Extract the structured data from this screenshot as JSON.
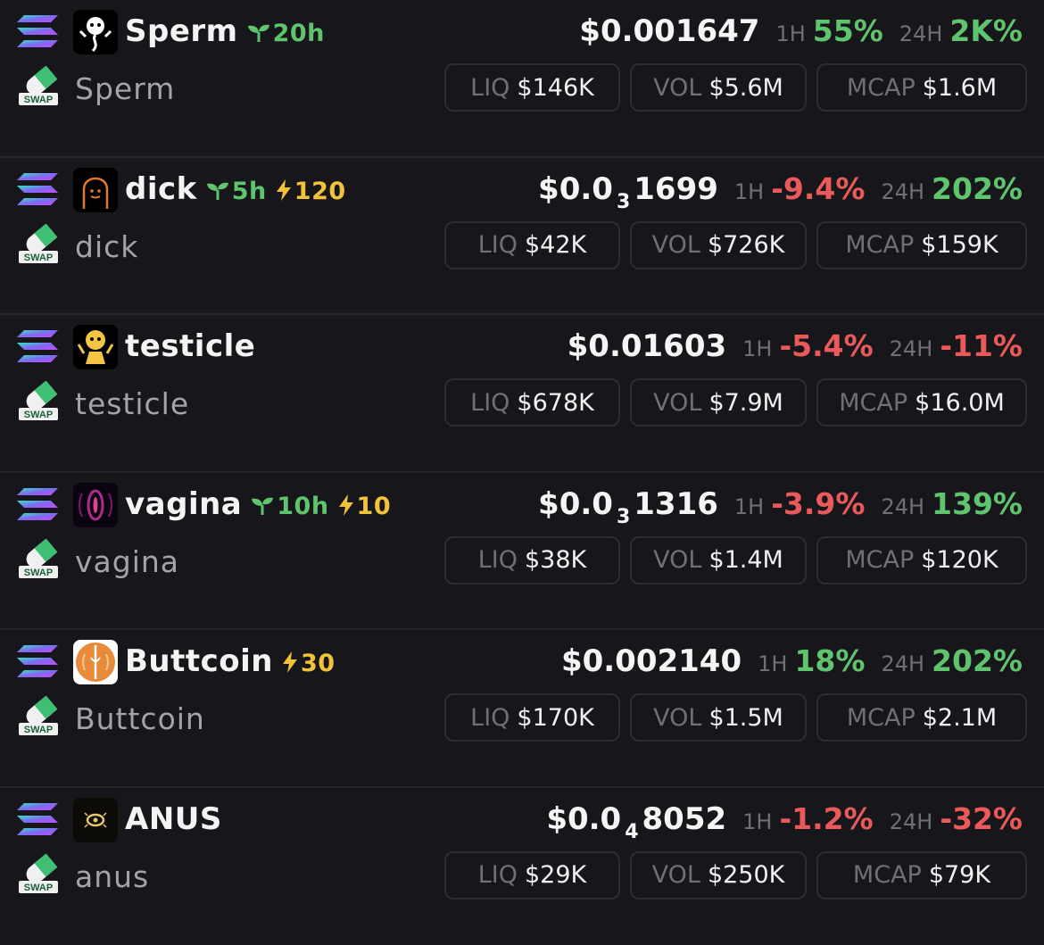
{
  "labels": {
    "h1": "1H",
    "h24": "24H",
    "liq": "LIQ",
    "vol": "VOL",
    "mcap": "MCAP"
  },
  "colors": {
    "background": "#17171b",
    "positive": "#5fc46e",
    "negative": "#ea5a5a",
    "boost": "#f2c23a",
    "muted": "#6f6f76"
  },
  "chain_icon": "solana-chain-icon",
  "dex_icon": "swap-pill-icon",
  "tokens": [
    {
      "symbol": "Sperm",
      "name": "Sperm",
      "logo": "sperm-logo-icon",
      "age": "20h",
      "boost": "",
      "price_pre": "$0.001647",
      "price_zeros": "",
      "price_post": "",
      "change_1h": "55%",
      "change_1h_dir": "pos",
      "change_24h": "2K%",
      "change_24h_dir": "pos",
      "liq": "$146K",
      "vol": "$5.6M",
      "mcap": "$1.6M"
    },
    {
      "symbol": "dick",
      "name": "dick",
      "logo": "dick-logo-icon",
      "age": "5h",
      "boost": "120",
      "price_pre": "$0.0",
      "price_zeros": "3",
      "price_post": "1699",
      "change_1h": "-9.4%",
      "change_1h_dir": "neg",
      "change_24h": "202%",
      "change_24h_dir": "pos",
      "liq": "$42K",
      "vol": "$726K",
      "mcap": "$159K"
    },
    {
      "symbol": "testicle",
      "name": "testicle",
      "logo": "testicle-logo-icon",
      "age": "",
      "boost": "",
      "price_pre": "$0.01603",
      "price_zeros": "",
      "price_post": "",
      "change_1h": "-5.4%",
      "change_1h_dir": "neg",
      "change_24h": "-11%",
      "change_24h_dir": "neg",
      "liq": "$678K",
      "vol": "$7.9M",
      "mcap": "$16.0M"
    },
    {
      "symbol": "vagina",
      "name": "vagina",
      "logo": "vagina-logo-icon",
      "age": "10h",
      "boost": "10",
      "price_pre": "$0.0",
      "price_zeros": "3",
      "price_post": "1316",
      "change_1h": "-3.9%",
      "change_1h_dir": "neg",
      "change_24h": "139%",
      "change_24h_dir": "pos",
      "liq": "$38K",
      "vol": "$1.4M",
      "mcap": "$120K"
    },
    {
      "symbol": "Buttcoin",
      "name": "Buttcoin",
      "logo": "buttcoin-logo-icon",
      "age": "",
      "boost": "30",
      "price_pre": "$0.002140",
      "price_zeros": "",
      "price_post": "",
      "change_1h": "18%",
      "change_1h_dir": "pos",
      "change_24h": "202%",
      "change_24h_dir": "pos",
      "liq": "$170K",
      "vol": "$1.5M",
      "mcap": "$2.1M"
    },
    {
      "symbol": "ANUS",
      "name": "anus",
      "logo": "anus-logo-icon",
      "age": "",
      "boost": "",
      "price_pre": "$0.0",
      "price_zeros": "4",
      "price_post": "8052",
      "change_1h": "-1.2%",
      "change_1h_dir": "neg",
      "change_24h": "-32%",
      "change_24h_dir": "neg",
      "liq": "$29K",
      "vol": "$250K",
      "mcap": "$79K"
    }
  ]
}
